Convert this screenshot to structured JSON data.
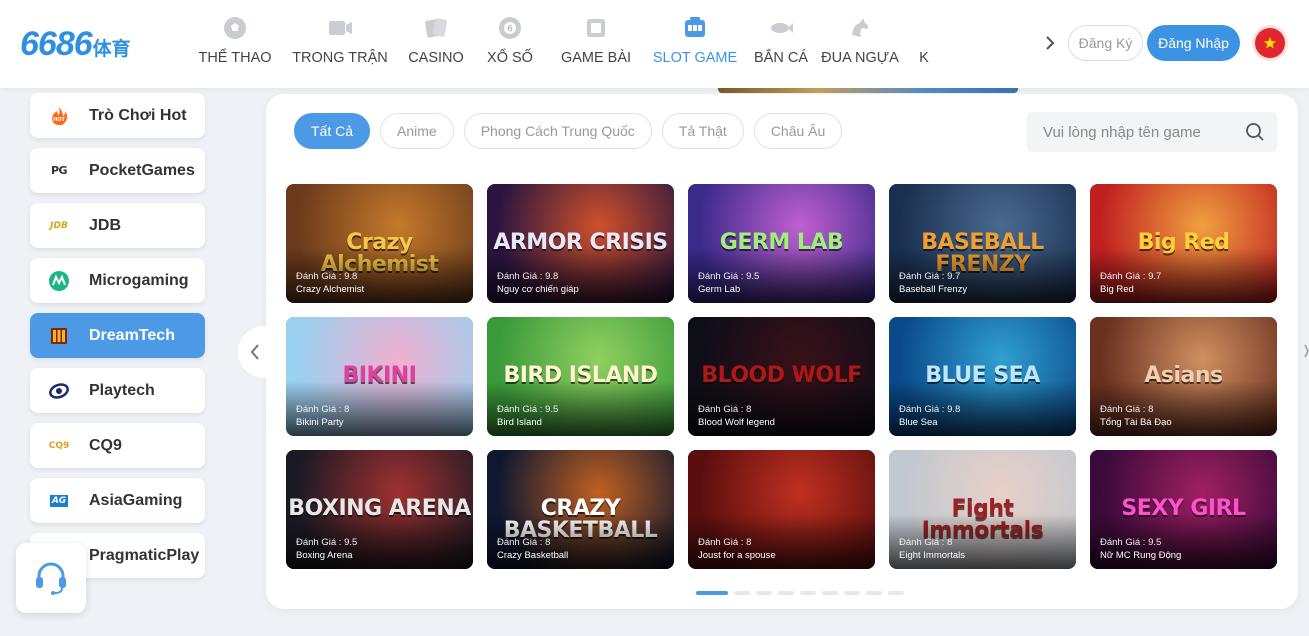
{
  "header": {
    "logo": {
      "number": "6686",
      "suffix": "体育"
    },
    "nav": [
      {
        "label": "THỂ THAO",
        "icon": "soccer-ball-icon",
        "active": false
      },
      {
        "label": "TRONG TRẬN",
        "icon": "video-camera-icon",
        "active": false
      },
      {
        "label": "CASINO",
        "icon": "playing-cards-icon",
        "active": false
      },
      {
        "label": "XỔ SỐ",
        "icon": "lottery-ball-icon",
        "active": false
      },
      {
        "label": "GAME BÀI",
        "icon": "card-game-icon",
        "active": false
      },
      {
        "label": "SLOT GAME",
        "icon": "slot-machine-icon",
        "active": true
      },
      {
        "label": "BẮN CÁ",
        "icon": "fish-icon",
        "active": false
      },
      {
        "label": "ĐUA NGỰA",
        "icon": "horse-icon",
        "active": false
      },
      {
        "label": "K",
        "icon": "",
        "active": false
      }
    ],
    "register_label": "Đăng Ký",
    "login_label": "Đăng Nhập",
    "language": "vietnam-flag-icon"
  },
  "sidebar": {
    "items": [
      {
        "label": "Trò Chơi Hot",
        "icon": "hot-flame-icon",
        "active": false
      },
      {
        "label": "PocketGames",
        "icon": "pg-logo-icon",
        "active": false
      },
      {
        "label": "JDB",
        "icon": "jdb-logo-icon",
        "active": false
      },
      {
        "label": "Microgaming",
        "icon": "microgaming-logo-icon",
        "active": false
      },
      {
        "label": "DreamTech",
        "icon": "dreamtech-logo-icon",
        "active": true
      },
      {
        "label": "Playtech",
        "icon": "playtech-logo-icon",
        "active": false
      },
      {
        "label": "CQ9",
        "icon": "cq9-logo-icon",
        "active": false
      },
      {
        "label": "AsiaGaming",
        "icon": "asiagaming-logo-icon",
        "active": false
      },
      {
        "label": "PragmaticPlay",
        "icon": "pragmaticplay-logo-icon",
        "active": false
      }
    ],
    "support_icon": "headset-support-icon"
  },
  "filters": [
    {
      "label": "Tất Cả",
      "active": true
    },
    {
      "label": "Anime",
      "active": false
    },
    {
      "label": "Phong Cách Trung Quốc",
      "active": false
    },
    {
      "label": "Tả Thật",
      "active": false
    },
    {
      "label": "Châu Âu",
      "active": false
    }
  ],
  "search": {
    "placeholder": "Vui lòng nhập tên game",
    "value": ""
  },
  "rating_prefix": "Đánh Giá : ",
  "games": [
    {
      "name": "Crazy Alchemist",
      "rating": "9.8",
      "art_text": "Crazy Alchemist",
      "colors": [
        "#6b3a1c",
        "#c47a2a"
      ],
      "text_color": "#f5c84a"
    },
    {
      "name": "Nguy cơ chiến giáp",
      "rating": "9.8",
      "art_text": "ARMOR CRISIS",
      "colors": [
        "#2a1540",
        "#d0502a"
      ],
      "text_color": "#e8e8f8"
    },
    {
      "name": "Germ Lab",
      "rating": "9.5",
      "art_text": "GERM LAB",
      "colors": [
        "#3a2a8a",
        "#c060d0"
      ],
      "text_color": "#9ef07a"
    },
    {
      "name": "Baseball Frenzy",
      "rating": "9.7",
      "art_text": "BASEBALL FRENZY",
      "colors": [
        "#1a3050",
        "#4a6a90"
      ],
      "text_color": "#f0a030"
    },
    {
      "name": "Big Red",
      "rating": "9.7",
      "art_text": "Big Red",
      "colors": [
        "#c02020",
        "#f0a040"
      ],
      "text_color": "#ffd23a"
    },
    {
      "name": "Bikini Party",
      "rating": "8",
      "art_text": "BIKINI",
      "colors": [
        "#9ad0f0",
        "#f0b0d0"
      ],
      "text_color": "#e040a0"
    },
    {
      "name": "Bird Island",
      "rating": "9.5",
      "art_text": "BIRD ISLAND",
      "colors": [
        "#3a9a3a",
        "#90d060"
      ],
      "text_color": "#fff6d0"
    },
    {
      "name": "Blood Wolf legend",
      "rating": "8",
      "art_text": "BLOOD WOLF",
      "colors": [
        "#0e0e18",
        "#3a1018"
      ],
      "text_color": "#b01818"
    },
    {
      "name": "Blue Sea",
      "rating": "9.8",
      "art_text": "BLUE SEA",
      "colors": [
        "#0a4a8a",
        "#30a0d0"
      ],
      "text_color": "#bfe8ff"
    },
    {
      "name": "Tổng Tài Bá Đạo",
      "rating": "8",
      "art_text": "Asians",
      "colors": [
        "#6a3020",
        "#d09060"
      ],
      "text_color": "#f0d0b0"
    },
    {
      "name": "Boxing Arena",
      "rating": "9.5",
      "art_text": "BOXING ARENA",
      "colors": [
        "#1a1a24",
        "#a03030"
      ],
      "text_color": "#e8e8e8"
    },
    {
      "name": "Crazy Basketball",
      "rating": "8",
      "art_text": "CRAZY BASKETBALL",
      "colors": [
        "#101830",
        "#c06020"
      ],
      "text_color": "#ffffff"
    },
    {
      "name": "Joust for a spouse",
      "rating": "8",
      "art_text": "",
      "colors": [
        "#5a0e0e",
        "#c03020"
      ],
      "text_color": "#f0c040"
    },
    {
      "name": "Eight Immortals",
      "rating": "8",
      "art_text": "Fight Immortals",
      "colors": [
        "#c0c8d0",
        "#e8d0c8"
      ],
      "text_color": "#a02020"
    },
    {
      "name": "Nữ MC Rung Động",
      "rating": "9.5",
      "art_text": "SEXY GIRL",
      "colors": [
        "#3a0a3a",
        "#a02060"
      ],
      "text_color": "#ff50d0"
    }
  ],
  "pagination": {
    "pages": 9,
    "current": 1
  }
}
